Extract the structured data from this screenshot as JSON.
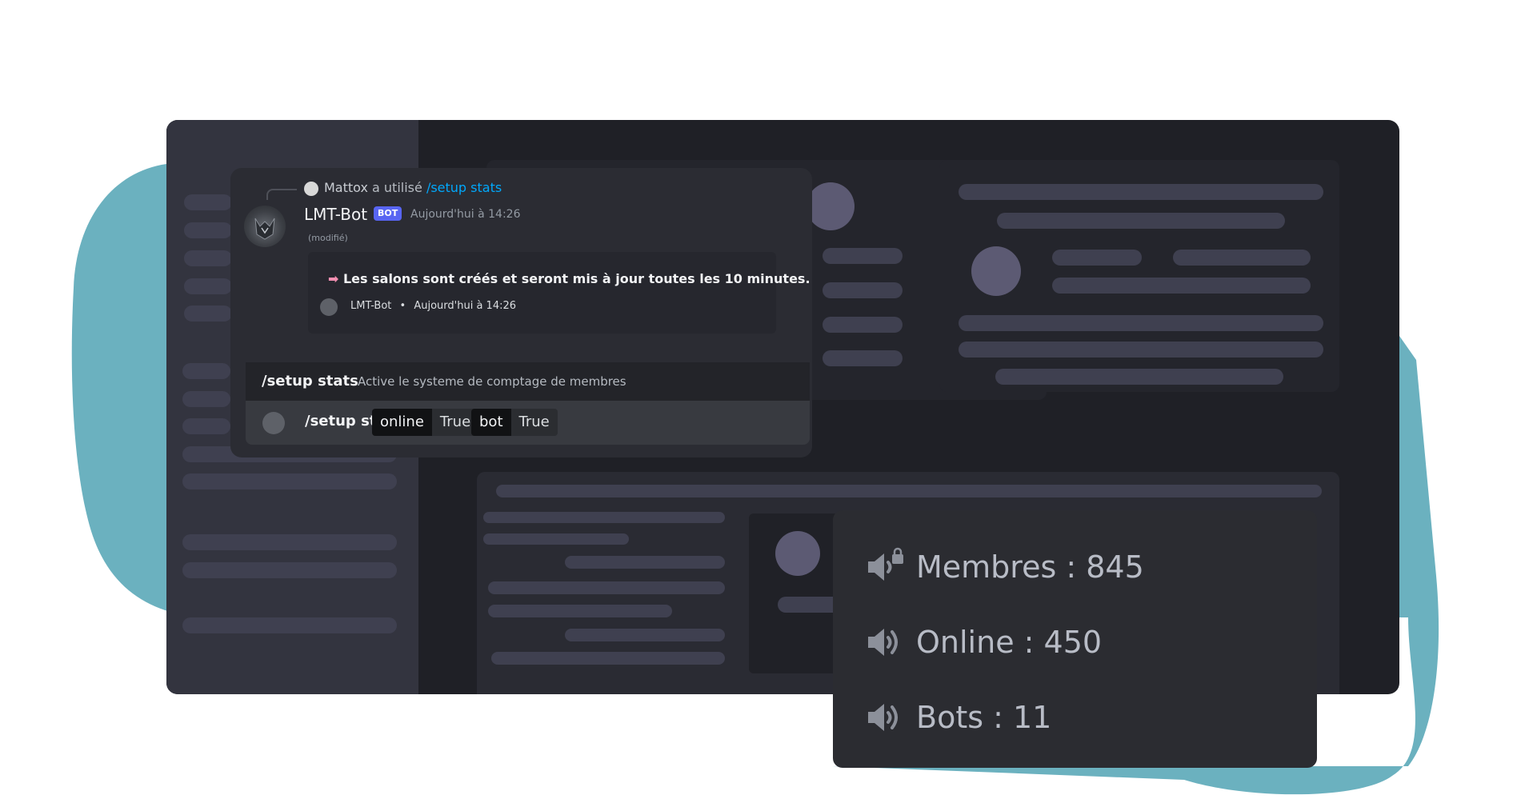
{
  "chat": {
    "reply_user": "Mattox",
    "reply_action": "a utilisé",
    "reply_command": "/setup stats",
    "bot_name": "LMT-Bot",
    "bot_tag": "BOT",
    "bot_time": "Aujourd'hui à 14:26",
    "edited_label": "(modifié)",
    "embed_arrow": "➡",
    "embed_text": "Les salons sont créés et seront mis à jour toutes les 10 minutes.",
    "embed_footer_name": "LMT-Bot",
    "embed_footer_separator": "•",
    "embed_footer_time": "Aujourd'hui à 14:26"
  },
  "command_hint": {
    "name": "/setup stats",
    "description": "Active le systeme de comptage de membres"
  },
  "command_input": {
    "command": "/setup stats",
    "options": [
      {
        "name": "online",
        "value": "True"
      },
      {
        "name": "bot",
        "value": "True"
      }
    ]
  },
  "channels": [
    {
      "icon": "locked-speaker-icon",
      "label": "Membres : 845"
    },
    {
      "icon": "speaker-icon",
      "label": "Online : 450"
    },
    {
      "icon": "speaker-icon",
      "label": "Bots : 11"
    }
  ],
  "colors": {
    "blob": "#6bb1bf",
    "frame": "#1f2026",
    "sidebar": "#33343f",
    "bot_tag": "#5865f2",
    "link": "#00a8fc"
  }
}
